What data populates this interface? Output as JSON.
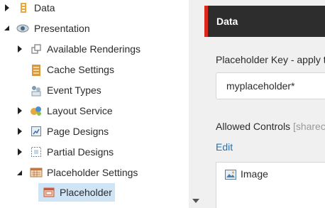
{
  "tree": {
    "items": [
      {
        "label": "Data",
        "expanded": false,
        "icon": "data-folder-icon"
      },
      {
        "label": "Presentation",
        "expanded": true,
        "icon": "eye-icon"
      },
      {
        "label": "Available Renderings",
        "expanded": false,
        "icon": "renderings-icon"
      },
      {
        "label": "Cache Settings",
        "expanded": null,
        "icon": "cache-settings-icon"
      },
      {
        "label": "Event Types",
        "expanded": null,
        "icon": "event-types-icon"
      },
      {
        "label": "Layout Service",
        "expanded": false,
        "icon": "layout-service-icon"
      },
      {
        "label": "Page Designs",
        "expanded": false,
        "icon": "page-designs-icon"
      },
      {
        "label": "Partial Designs",
        "expanded": false,
        "icon": "partial-designs-icon"
      },
      {
        "label": "Placeholder Settings",
        "expanded": true,
        "icon": "placeholder-settings-icon"
      },
      {
        "label": "Placeholder",
        "expanded": null,
        "icon": "placeholder-icon",
        "selected": true
      }
    ]
  },
  "panel": {
    "section_title": "Data",
    "field_label": "Placeholder Key - apply t",
    "key_value": "myplaceholder*",
    "controls_label": "Allowed Controls ",
    "controls_shared": "[sharec",
    "edit_link": "Edit",
    "allowed_items": [
      "Image"
    ]
  },
  "colors": {
    "accent_red": "#dc291e",
    "header_dark": "#2d2d2d",
    "link_blue": "#1f73b7",
    "selection": "#cfe4f5"
  }
}
